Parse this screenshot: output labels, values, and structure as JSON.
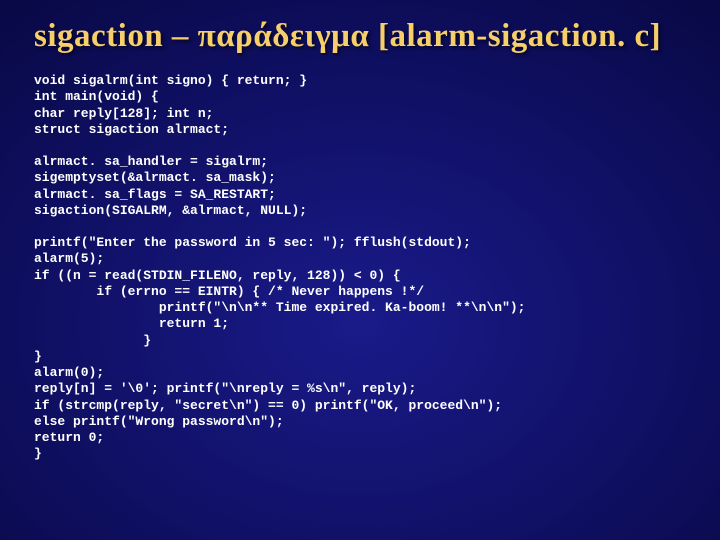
{
  "title": "sigaction – παράδειγμα [alarm-sigaction. c]",
  "code": {
    "block1": "void sigalrm(int signo) { return; }\nint main(void) {\nchar reply[128]; int n;\nstruct sigaction alrmact;",
    "block2": "alrmact. sa_handler = sigalrm;\nsigemptyset(&alrmact. sa_mask);\nalrmact. sa_flags = SA_RESTART;\nsigaction(SIGALRM, &alrmact, NULL);",
    "block3": "printf(\"Enter the password in 5 sec: \"); fflush(stdout);\nalarm(5);\nif ((n = read(STDIN_FILENO, reply, 128)) < 0) {\n        if (errno == EINTR) { /* Never happens !*/\n                printf(\"\\n\\n** Time expired. Ka-boom! **\\n\\n\");\n                return 1;\n              }\n}\nalarm(0);\nreply[n] = '\\0'; printf(\"\\nreply = %s\\n\", reply);\nif (strcmp(reply, \"secret\\n\") == 0) printf(\"OK, proceed\\n\");\nelse printf(\"Wrong password\\n\");\nreturn 0;\n}"
  }
}
